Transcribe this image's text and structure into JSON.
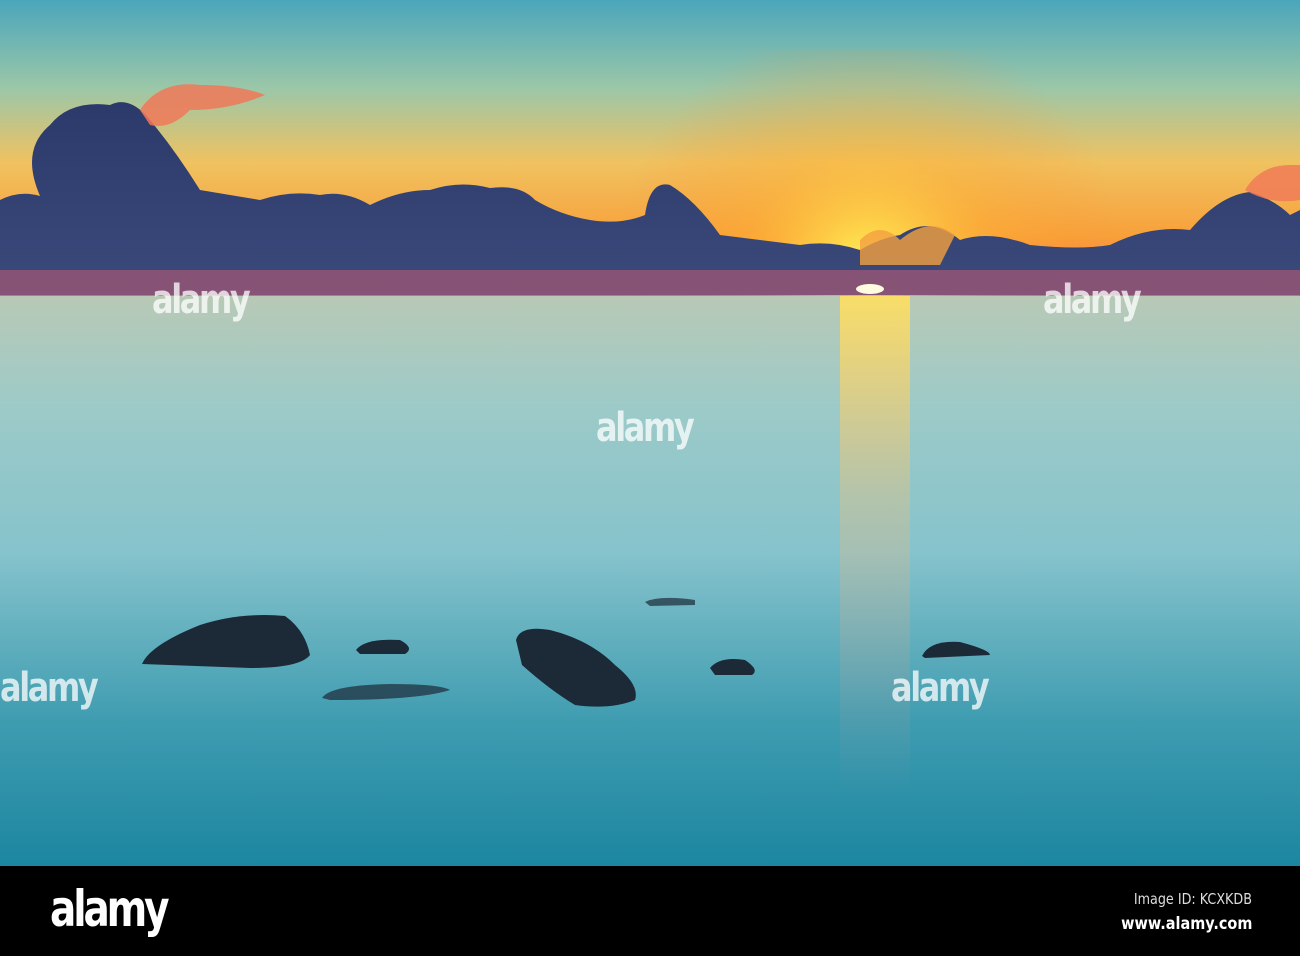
{
  "photo": {
    "watermark": "alamy",
    "colors": {
      "sky_top": "#4fa8b8",
      "sky_horizon": "#f7a23a",
      "sun": "#fff3a0",
      "cloud": "#2a3760",
      "water_top": "#a8c8c0",
      "water_bottom": "#1f8aa3",
      "rock": "#1c2a38"
    }
  },
  "footer": {
    "logo": "alamy",
    "image_id": "Image ID: KCXKDB",
    "url": "www.alamy.com"
  }
}
